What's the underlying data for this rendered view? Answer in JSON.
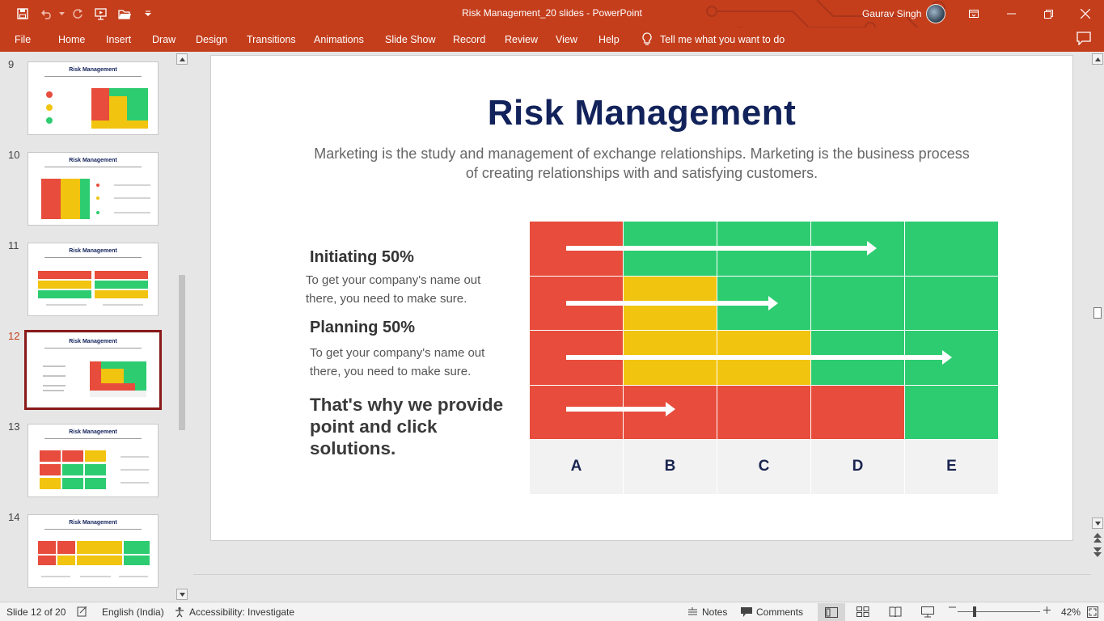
{
  "app": {
    "title": "Risk Management_20 slides  -  PowerPoint",
    "user_name": "Gaurav Singh",
    "accent": "#c43e1c"
  },
  "ribbon": {
    "tabs": [
      "File",
      "Home",
      "Insert",
      "Draw",
      "Design",
      "Transitions",
      "Animations",
      "Slide Show",
      "Record",
      "Review",
      "View",
      "Help"
    ],
    "tell_me": "Tell me what you want to do"
  },
  "thumbnails": {
    "numbers": [
      "9",
      "10",
      "11",
      "12",
      "13",
      "14"
    ],
    "title": "Risk Management",
    "active_index": 3
  },
  "slide": {
    "title": "Risk Management",
    "subtitle": "Marketing is the study and management of exchange relationships. Marketing is the business process of creating relationships with and satisfying customers.",
    "items": [
      {
        "heading": "Initiating 50%",
        "body": "To get your company's name out there, you need to make sure."
      },
      {
        "heading": "Planning 50%",
        "body": "To get your company's name out there, you need to make sure."
      }
    ],
    "tagline": "That's why we provide point and click solutions.",
    "colors": {
      "red": "#e74c3c",
      "green": "#2ecc71",
      "yellow": "#f1c40f",
      "navy": "#12225a"
    },
    "matrix": {
      "columns": [
        "A",
        "B",
        "C",
        "D",
        "E"
      ],
      "rows": [
        [
          "red",
          "green",
          "green",
          "green",
          "green"
        ],
        [
          "red",
          "yellow",
          "green",
          "green",
          "green"
        ],
        [
          "red",
          "yellow",
          "yellow",
          "green",
          "green"
        ],
        [
          "red",
          "red",
          "red",
          "red",
          "green"
        ]
      ],
      "arrows_end_column": [
        3.7,
        2.65,
        4.5,
        1.55
      ]
    }
  },
  "status": {
    "slide_indicator": "Slide 12 of 20",
    "language": "English (India)",
    "accessibility": "Accessibility: Investigate",
    "notes": "Notes",
    "comments": "Comments",
    "zoom": "42%"
  }
}
